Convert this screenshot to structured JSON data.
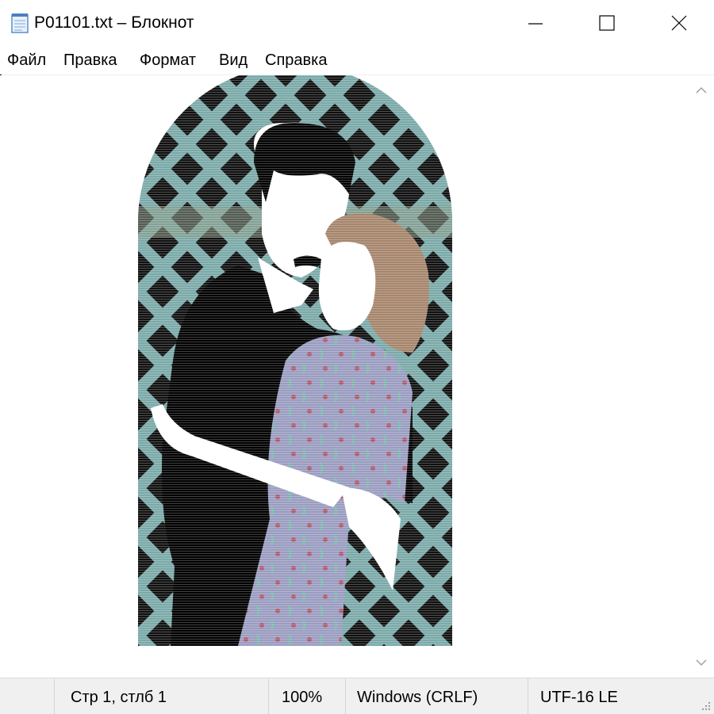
{
  "window": {
    "title": "P01101.txt – Блокнот",
    "icon": "notepad-icon",
    "controls": [
      "minimize-icon",
      "maximize-icon",
      "close-icon"
    ]
  },
  "menu": {
    "items": [
      {
        "label": "Файл"
      },
      {
        "label": "Правка"
      },
      {
        "label": "Формат"
      },
      {
        "label": "Вид"
      },
      {
        "label": "Справка"
      }
    ]
  },
  "content": {
    "art": "ascii-art-dancing-couple",
    "colors": {
      "lattice": "#7aa9a8",
      "dark": "#000000",
      "hair": "#a6856c",
      "dress": "#9a9cc0",
      "skin": "#ffffff"
    }
  },
  "status": {
    "position": "Стр 1, стлб 1",
    "zoom": "100%",
    "line_endings": "Windows (CRLF)",
    "encoding": "UTF-16 LE"
  }
}
